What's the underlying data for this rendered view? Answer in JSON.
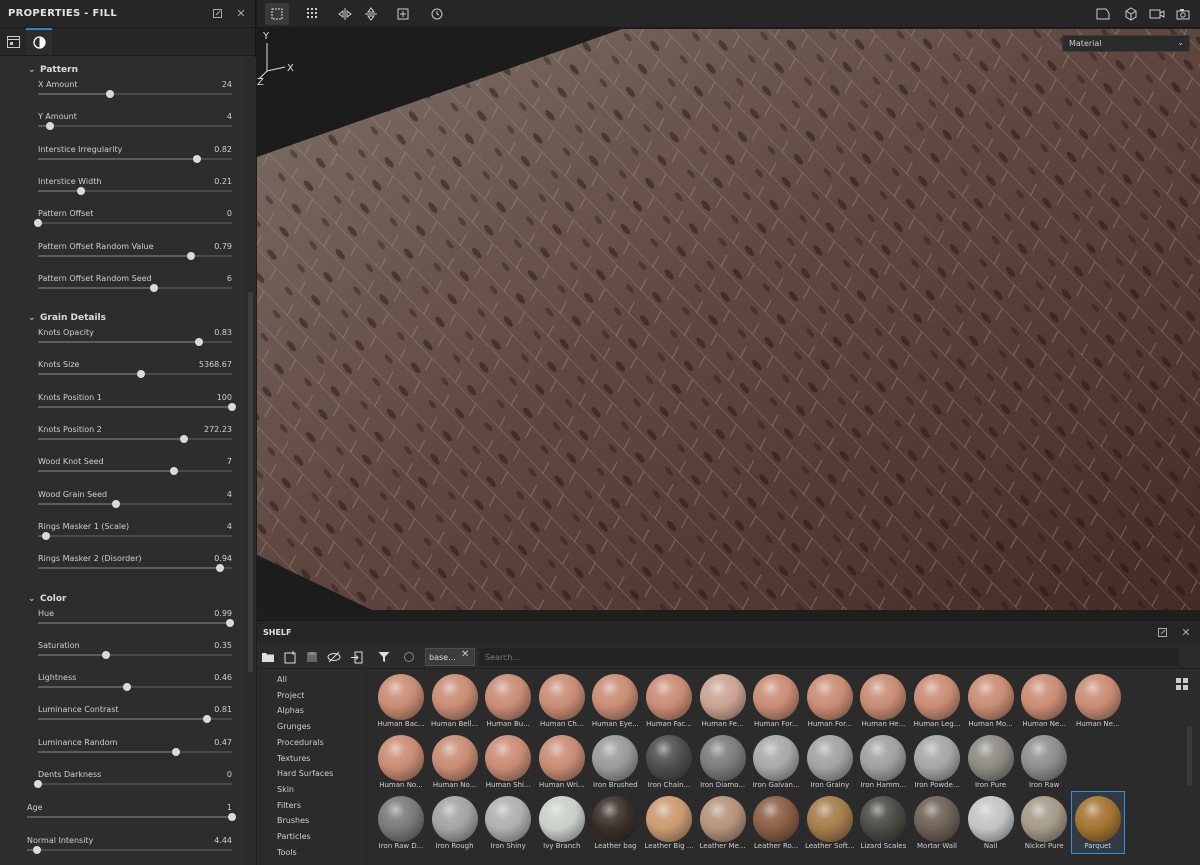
{
  "properties": {
    "title": "PROPERTIES - FILL",
    "sections": [
      {
        "name": "Pattern",
        "props": [
          {
            "label": "X Amount",
            "value": "24",
            "pos": 0.37
          },
          {
            "label": "Y Amount",
            "value": "4",
            "pos": 0.06
          },
          {
            "label": "Interstice Irregularity",
            "value": "0.82",
            "pos": 0.82
          },
          {
            "label": "Interstice Width",
            "value": "0.21",
            "pos": 0.22
          },
          {
            "label": "Pattern Offset",
            "value": "0",
            "pos": 0.0
          },
          {
            "label": "Pattern Offset Random Value",
            "value": "0.79",
            "pos": 0.79
          },
          {
            "label": "Pattern Offset Random Seed",
            "value": "6",
            "pos": 0.6
          }
        ]
      },
      {
        "name": "Grain Details",
        "props": [
          {
            "label": "Knots Opacity",
            "value": "0.83",
            "pos": 0.83
          },
          {
            "label": "Knots Size",
            "value": "5368.67",
            "pos": 0.53
          },
          {
            "label": "Knots Position 1",
            "value": "100",
            "pos": 1.0
          },
          {
            "label": "Knots Position 2",
            "value": "272.23",
            "pos": 0.75
          },
          {
            "label": "Wood Knot Seed",
            "value": "7",
            "pos": 0.7
          },
          {
            "label": "Wood Grain Seed",
            "value": "4",
            "pos": 0.4
          },
          {
            "label": "Rings Masker 1 (Scale)",
            "value": "4",
            "pos": 0.04
          },
          {
            "label": "Rings Masker 2 (Disorder)",
            "value": "0.94",
            "pos": 0.94
          }
        ]
      },
      {
        "name": "Color",
        "props": [
          {
            "label": "Hue",
            "value": "0.99",
            "pos": 0.99
          },
          {
            "label": "Saturation",
            "value": "0.35",
            "pos": 0.35
          },
          {
            "label": "Lightness",
            "value": "0.46",
            "pos": 0.46
          },
          {
            "label": "Luminance Contrast",
            "value": "0.81",
            "pos": 0.87
          },
          {
            "label": "Luminance Random",
            "value": "0.47",
            "pos": 0.71
          },
          {
            "label": "Dents Darkness",
            "value": "0",
            "pos": 0.0
          }
        ]
      }
    ],
    "extra_props": [
      {
        "label": "Age",
        "value": "1",
        "pos": 1.0
      },
      {
        "label": "Normal Intensity",
        "value": "4.44",
        "pos": 0.05
      }
    ]
  },
  "viewport": {
    "mode_select": "Material"
  },
  "shelf": {
    "title": "SHELF",
    "filter_chip": "base...",
    "search_placeholder": "Search...",
    "categories": [
      "All",
      "Project",
      "Alphas",
      "Grunges",
      "Procedurals",
      "Textures",
      "Hard Surfaces",
      "Skin",
      "Filters",
      "Brushes",
      "Particles",
      "Tools"
    ],
    "rows": [
      [
        {
          "name": "Human Bac...",
          "color": "#c98c74"
        },
        {
          "name": "Human Bell...",
          "color": "#c98c74"
        },
        {
          "name": "Human Bu...",
          "color": "#c98c74"
        },
        {
          "name": "Human Ch...",
          "color": "#c98c74"
        },
        {
          "name": "Human Eye...",
          "color": "#c98c74"
        },
        {
          "name": "Human Fac...",
          "color": "#c98c74"
        },
        {
          "name": "Human Fe...",
          "color": "#c9a393"
        },
        {
          "name": "Human For...",
          "color": "#c98c74"
        },
        {
          "name": "Human For...",
          "color": "#c98c74"
        },
        {
          "name": "Human He...",
          "color": "#c98c74"
        },
        {
          "name": "Human Leg...",
          "color": "#c98c74"
        },
        {
          "name": "Human Mo...",
          "color": "#c98c74"
        },
        {
          "name": "Human Ne...",
          "color": "#c98c74"
        },
        {
          "name": "Human Ne...",
          "color": "#c98c74"
        }
      ],
      [
        {
          "name": "Human No...",
          "color": "#c98c74"
        },
        {
          "name": "Human No...",
          "color": "#c98c74"
        },
        {
          "name": "Human Shi...",
          "color": "#c98c74"
        },
        {
          "name": "Human Wri...",
          "color": "#c98c74"
        },
        {
          "name": "Iron Brushed",
          "color": "#9a9a9a"
        },
        {
          "name": "Iron Chain...",
          "color": "#4e4e4e"
        },
        {
          "name": "Iron Diamo...",
          "color": "#7c7c7c"
        },
        {
          "name": "Iron Galvan...",
          "color": "#a8a8a8"
        },
        {
          "name": "Iron Grainy",
          "color": "#a3a3a3"
        },
        {
          "name": "Iron Hamm...",
          "color": "#a0a0a0"
        },
        {
          "name": "Iron Powde...",
          "color": "#a6a6a6"
        },
        {
          "name": "Iron Pure",
          "color": "#8d8a83"
        },
        {
          "name": "Iron Raw",
          "color": "#8e8e8e"
        }
      ],
      [
        {
          "name": "Iron Raw D...",
          "color": "#7a7a7a"
        },
        {
          "name": "Iron Rough",
          "color": "#a3a3a3"
        },
        {
          "name": "Iron Shiny",
          "color": "#b0b0b0"
        },
        {
          "name": "Ivy Branch",
          "color": "#c9cfc9"
        },
        {
          "name": "Leather bag",
          "color": "#3a302b"
        },
        {
          "name": "Leather Big ...",
          "color": "#c99a70"
        },
        {
          "name": "Leather Me...",
          "color": "#b5937a"
        },
        {
          "name": "Leather Ro...",
          "color": "#8a5f44"
        },
        {
          "name": "Leather Soft...",
          "color": "#a47d4b"
        },
        {
          "name": "Lizard Scales",
          "color": "#4c4c46"
        },
        {
          "name": "Mortar Wall",
          "color": "#6e6156"
        },
        {
          "name": "Nail",
          "color": "#c4c4c4"
        },
        {
          "name": "Nickel Pure",
          "color": "#a59a8a"
        },
        {
          "name": "Parquet",
          "color": "#a57431"
        }
      ]
    ],
    "selected": "Parquet"
  },
  "colors": {
    "accent": "#2f86c7",
    "panel": "#2d2d2d",
    "wood_dark": "#3b2a24",
    "wood_light": "#7a6a62"
  }
}
